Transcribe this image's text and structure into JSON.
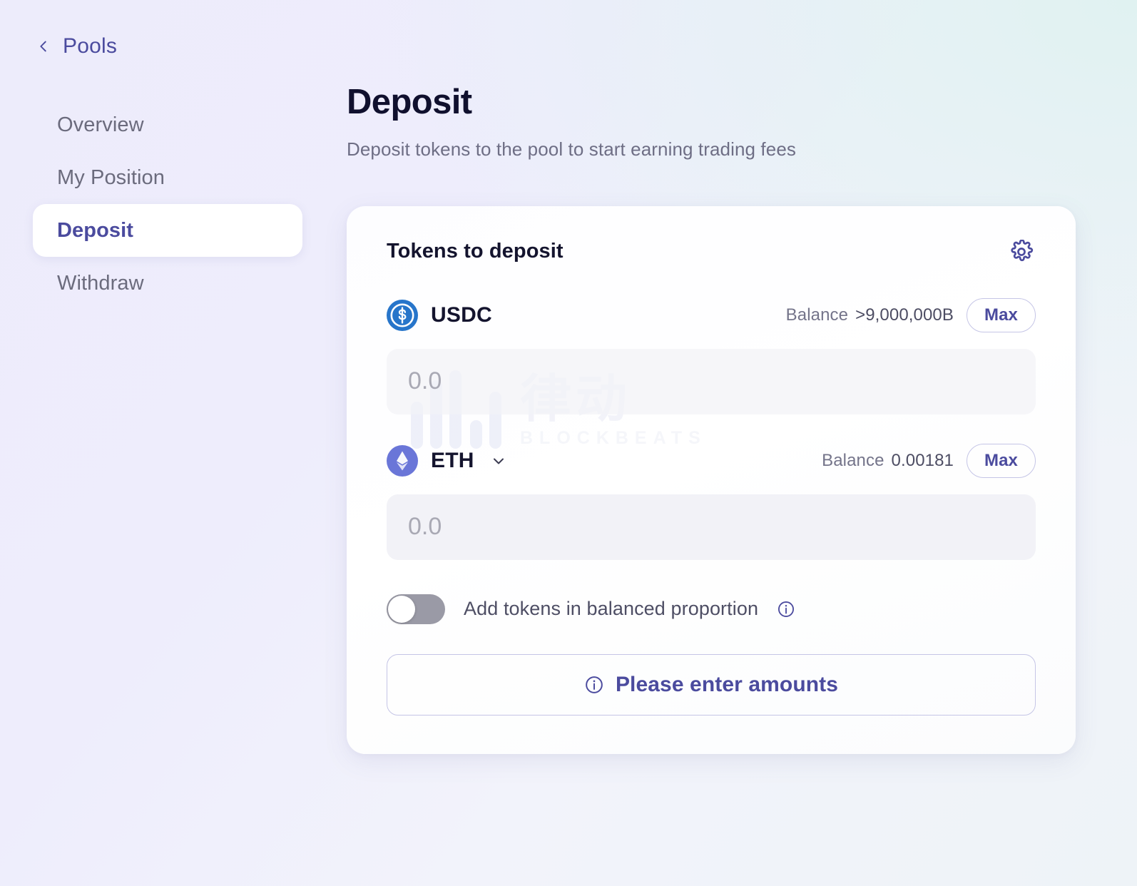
{
  "sidebar": {
    "back": {
      "label": "Pools",
      "icon": "chevron-left-icon"
    },
    "items": [
      {
        "label": "Overview",
        "active": false
      },
      {
        "label": "My Position",
        "active": false
      },
      {
        "label": "Deposit",
        "active": true
      },
      {
        "label": "Withdraw",
        "active": false
      }
    ]
  },
  "main": {
    "title": "Deposit",
    "subtitle": "Deposit tokens to the pool to start earning trading fees"
  },
  "card": {
    "title": "Tokens to deposit",
    "settings_icon": "gear-icon",
    "tokens": [
      {
        "symbol": "USDC",
        "logo": "usdc-icon",
        "has_dropdown": false,
        "balance_label": "Balance",
        "balance_value": ">9,000,000B",
        "max_label": "Max",
        "amount_value": "",
        "amount_placeholder": "0.0"
      },
      {
        "symbol": "ETH",
        "logo": "eth-icon",
        "has_dropdown": true,
        "balance_label": "Balance",
        "balance_value": "0.00181",
        "max_label": "Max",
        "amount_value": "",
        "amount_placeholder": "0.0"
      }
    ],
    "toggle": {
      "label": "Add tokens in balanced proportion",
      "state": "off",
      "info_icon": "info-icon"
    },
    "cta": {
      "label": "Please enter amounts",
      "icon": "info-icon",
      "disabled": true
    }
  },
  "watermark": {
    "cn": "律动",
    "en": "BLOCKBEATS"
  },
  "colors": {
    "accent": "#4b4b9e",
    "border": "#c5c5e6",
    "muted_text": "#6e6e85",
    "usdc_blue": "#2775ca",
    "eth_indigo": "#6a76d8",
    "input_bg": "#f2f2f7",
    "card_bg": "#ffffff"
  }
}
